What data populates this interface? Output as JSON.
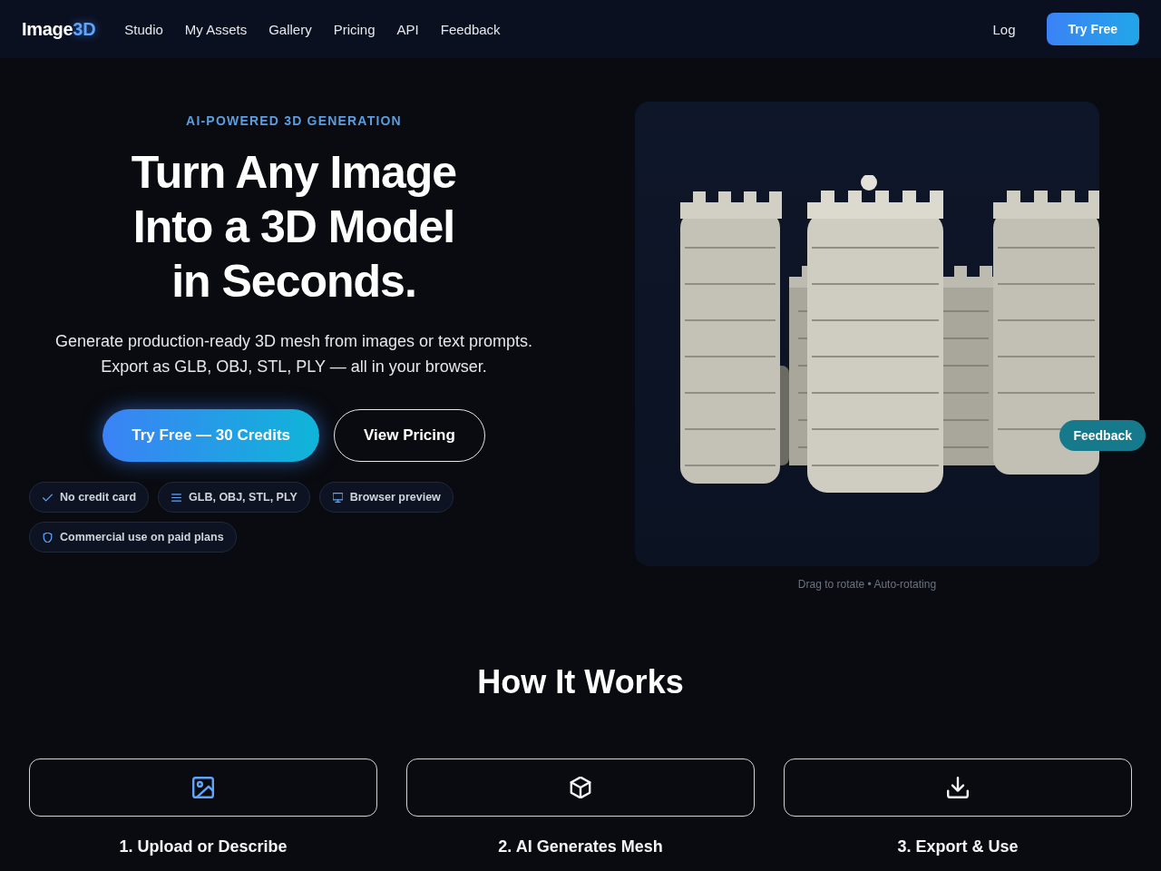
{
  "header": {
    "logo": {
      "text": "Image",
      "accent": "3D"
    },
    "nav": [
      "Studio",
      "My Assets",
      "Gallery",
      "Pricing",
      "API",
      "Feedback"
    ],
    "login": "Log",
    "cta": "Try Free"
  },
  "hero": {
    "eyebrow": "AI-POWERED 3D GENERATION",
    "title": "Turn Any Image\nInto a 3D Model\nin Seconds.",
    "subtitle": "Generate production-ready 3D mesh from images or text prompts.\nExport as GLB, OBJ, STL, PLY — all in your browser.",
    "buttons": [
      {
        "label": "Try Free — 30 Credits",
        "kind": "primary"
      },
      {
        "label": "View Pricing",
        "kind": "outline"
      }
    ],
    "features": [
      "No credit card",
      "GLB, OBJ, STL, PLY",
      "Browser preview",
      "Commercial use on paid plans"
    ]
  },
  "viewer": {
    "caption": "Drag to rotate • Auto-rotating"
  },
  "feedback_button": "Feedback",
  "how_it_works": {
    "title": "How It Works",
    "steps": [
      {
        "title": "1. Upload or Describe",
        "active": true
      },
      {
        "title": "2. AI Generates Mesh",
        "active": false
      },
      {
        "title": "3. Export & Use",
        "active": false
      }
    ]
  }
}
